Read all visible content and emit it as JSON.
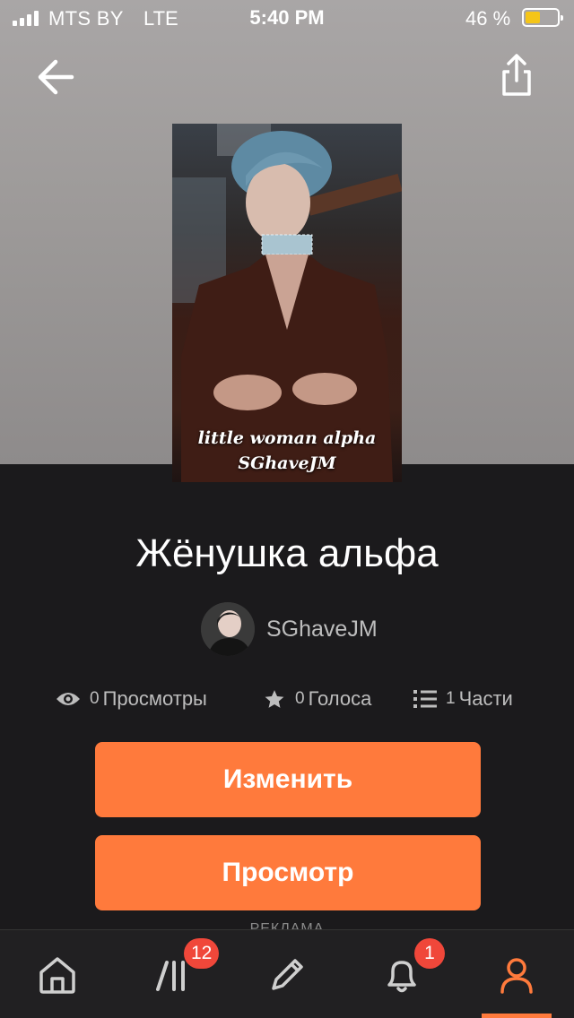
{
  "status_bar": {
    "carrier": "MTS BY",
    "network": "LTE",
    "time": "5:40 PM",
    "battery_percent": "46 %",
    "battery_level": 0.46
  },
  "header": {
    "back_icon": "arrow-left-icon",
    "share_icon": "share-icon"
  },
  "cover": {
    "line1": "little woman alpha",
    "line2": "SGhaveJM"
  },
  "story": {
    "title": "Жёнушка альфа",
    "author": "SGhaveJM"
  },
  "stats": {
    "views_count": "0",
    "views_label": "Просмотры",
    "votes_count": "0",
    "votes_label": "Голоса",
    "parts_count": "1",
    "parts_label": "Части"
  },
  "actions": {
    "edit_label": "Изменить",
    "preview_label": "Просмотр"
  },
  "ad_label": "РЕКЛАМА",
  "tabbar": {
    "library_badge": "12",
    "notifications_badge": "1",
    "active_tab": "profile"
  },
  "colors": {
    "accent": "#ff7a3c",
    "badge": "#f0473a",
    "background": "#1b1a1c"
  }
}
